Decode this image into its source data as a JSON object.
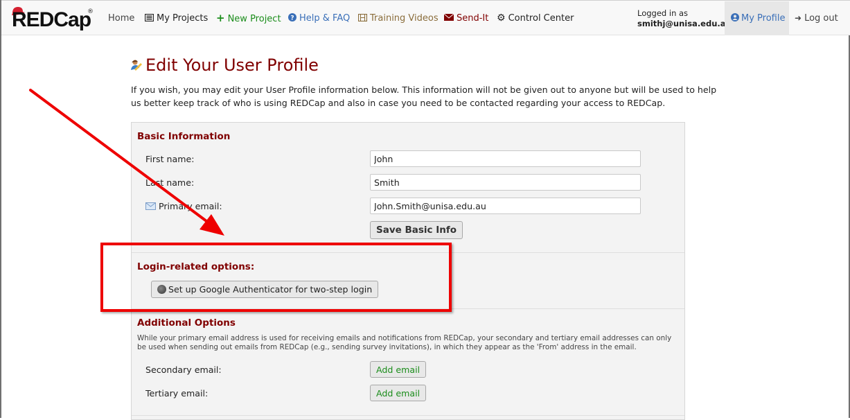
{
  "navbar": {
    "logo": "REDCap",
    "logo_reg": "®",
    "items": [
      {
        "label": "Home",
        "icon": ""
      },
      {
        "label": "My Projects",
        "icon": "list-icon"
      },
      {
        "label": "New Project",
        "icon": "plus-icon"
      },
      {
        "label": "Help & FAQ",
        "icon": "question-circle-icon"
      },
      {
        "label": "Training Videos",
        "icon": "film-icon"
      },
      {
        "label": "Send-It",
        "icon": "envelope-icon"
      },
      {
        "label": "Control Center",
        "icon": "gear-icon"
      }
    ],
    "logged_in_label": "Logged in as",
    "logged_in_user": "smithj@unisa.edu.au",
    "my_profile": "My Profile",
    "log_out": "Log out"
  },
  "page": {
    "title": "Edit Your User Profile",
    "intro": "If you wish, you may edit your User Profile information below. This information will not be given out to anyone but will be used to help us better keep track of who is using REDCap and also in case you need to be contacted regarding your access to REDCap."
  },
  "basic_info": {
    "title": "Basic Information",
    "first_name_label": "First name:",
    "first_name_value": "John",
    "last_name_label": "Last name:",
    "last_name_value": "Smith",
    "email_label": "Primary email:",
    "email_value": "John.Smith@unisa.edu.au",
    "save_button": "Save Basic Info"
  },
  "login_options": {
    "title": "Login-related options:",
    "google_auth_button": "Set up Google Authenticator for two-step login"
  },
  "additional_options": {
    "title": "Additional Options",
    "description": "While your primary email address is used for receiving emails and notifications from REDCap, your secondary and tertiary email addresses can only be used when sending out emails from REDCap (e.g., sending survey invitations), in which they appear as the 'From' address in the email.",
    "secondary_label": "Secondary email:",
    "tertiary_label": "Tertiary email:",
    "add_email_button": "Add email"
  },
  "colors": {
    "brand": "#800000",
    "link_blue": "#3a6fb8",
    "green": "#1b8d1b",
    "annotation_red": "#ee0000"
  }
}
